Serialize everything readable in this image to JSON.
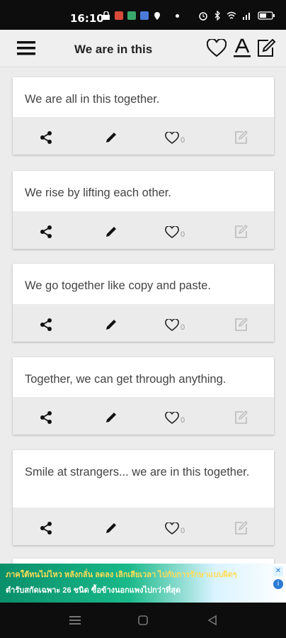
{
  "status_bar": {
    "time": "16:10",
    "icons_left": [
      "lock-icon",
      "app-icon",
      "app-icon",
      "app-icon",
      "location-icon",
      "dot-icon"
    ],
    "icons_right": [
      "alarm-icon",
      "bluetooth-icon",
      "wifi-icon",
      "signal-icon",
      "battery-icon"
    ]
  },
  "app_bar": {
    "title": "We are in this",
    "menu_icon": "hamburger-menu-icon",
    "actions": [
      "heart-icon",
      "font-icon",
      "edit-note-icon"
    ]
  },
  "quotes": [
    {
      "text": "We are all in this together.",
      "likes": "0"
    },
    {
      "text": "We rise by lifting each other.",
      "likes": "0"
    },
    {
      "text": "We go together like copy and paste.",
      "likes": "0"
    },
    {
      "text": "Together, we can get through anything.",
      "likes": "0"
    },
    {
      "text": "Smile at strangers... we are in this together.",
      "likes": "0"
    }
  ],
  "ad": {
    "line1": "ภาคใต้ทนไม่ไหว หลังกลั่น ลดลง เลิกเสียเวลา ไปกับการรักษาแบบผิดๆ",
    "line2": "ตำรับสกัดเฉพาะ 26 ชนิด ซื้อข้างนอกแพงไปกว่าที่สุด",
    "close_label": "✕",
    "info_label": "i"
  },
  "colors": {
    "status_bar": "#0d0d0d",
    "app_bar": "#efefef",
    "card_actions": "#ebebeb",
    "background": "#ececec"
  }
}
